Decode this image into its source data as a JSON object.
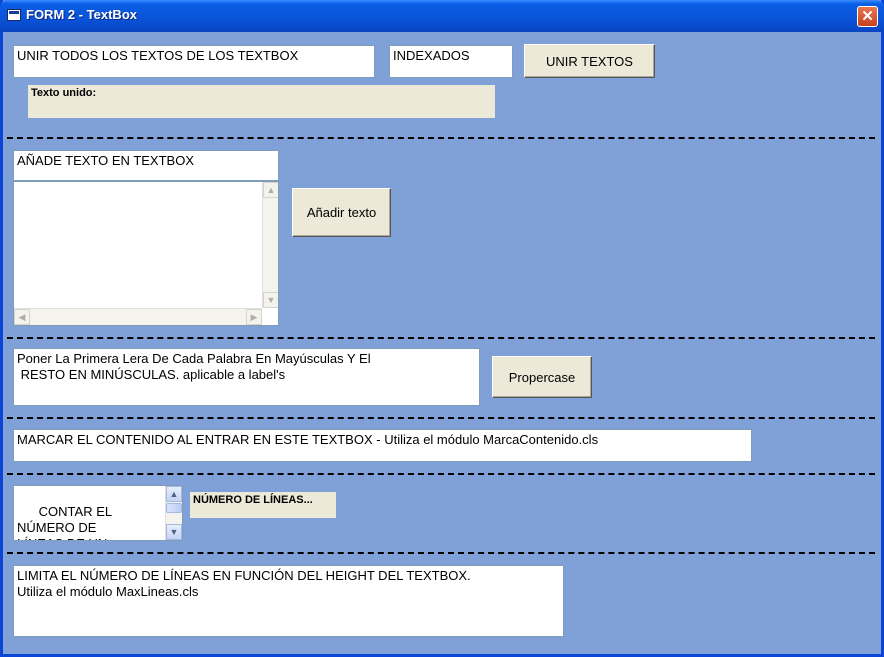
{
  "window": {
    "title": "FORM 2 - TextBox",
    "close_glyph": "✕"
  },
  "section1": {
    "main_textbox": "UNIR TODOS LOS TEXTOS DE LOS TEXTBOX",
    "indexed_textbox": "INDEXADOS",
    "join_button": "UNIR TEXTOS",
    "result_label": "Texto unido:"
  },
  "section2": {
    "input_textbox": "AÑADE TEXTO EN TEXTBOX",
    "multiline_textbox": "",
    "add_button": "Añadir texto"
  },
  "section3": {
    "propercase_textbox": "Poner La Primera Lera De Cada Palabra En Mayúsculas Y El\n RESTO EN MINÚSCULAS. aplicable a label's",
    "propercase_button": "Propercase"
  },
  "section4": {
    "mark_textbox": "MARCAR EL CONTENIDO AL ENTRAR EN ESTE TEXTBOX - Utiliza el módulo MarcaContenido.cls"
  },
  "section5": {
    "count_textbox": "CONTAR EL\nNÚMERO DE\nLÍNEAS DE UN",
    "count_label": "NÚMERO DE LÍNEAS..."
  },
  "section6": {
    "limit_textbox": "LIMITA EL NÚMERO DE LÍNEAS EN FUNCIÓN DEL HEIGHT DEL TEXTBOX.\nUtiliza el módulo MaxLineas.cls"
  },
  "icons": {
    "up": "▲",
    "down": "▼",
    "left": "◀",
    "right": "▶"
  },
  "colors": {
    "client_bg": "#7fa1d8",
    "titlebar": "#0a53d8",
    "control_bg": "#ece9d8"
  }
}
